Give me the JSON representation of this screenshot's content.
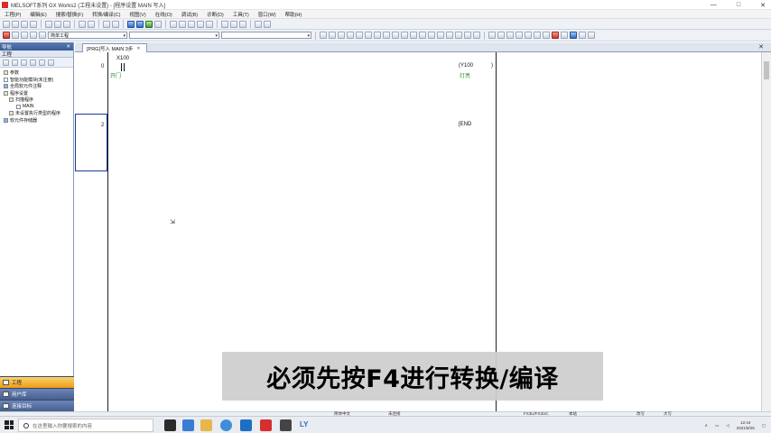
{
  "window": {
    "title": "MELSOFT系列 GX Works2 (工程未设置) - [程序设置 MAIN 写入]",
    "controls": [
      "—",
      "□",
      "✕"
    ]
  },
  "menu": [
    "工程(P)",
    "编辑(E)",
    "搜索/替换(F)",
    "转换/编译(C)",
    "视图(V)",
    "在线(O)",
    "调试(B)",
    "诊断(D)",
    "工具(T)",
    "窗口(W)",
    "帮助(H)"
  ],
  "toolbar": {
    "combo_label": "简单工程"
  },
  "nav": {
    "header": "导航",
    "subheader": "工程",
    "tree": [
      {
        "label": "参数",
        "icon": "folder",
        "depth": 0
      },
      {
        "label": "智能功能模块(未注册)",
        "icon": "doc",
        "depth": 0
      },
      {
        "label": "全局软元件注释",
        "icon": "doc",
        "depth": 0
      },
      {
        "label": "程序设置",
        "icon": "folder",
        "depth": 0
      },
      {
        "label": "扫描程序",
        "icon": "folder",
        "depth": 1
      },
      {
        "label": "MAIN",
        "icon": "doc",
        "depth": 2
      },
      {
        "label": "未设置执行类型的程序",
        "icon": "folder",
        "depth": 1
      },
      {
        "label": "软元件存储器",
        "icon": "doc",
        "depth": 0
      }
    ],
    "tabs": [
      {
        "label": "工程",
        "active": true
      },
      {
        "label": "用户库",
        "active": false
      },
      {
        "label": "连接目标",
        "active": false
      }
    ]
  },
  "editor": {
    "tab_label": "[PRG]写入 MAIN 3步",
    "steps": [
      "0",
      "2"
    ],
    "contact_device": "X100",
    "contact_comment": "开门",
    "coil_device": "(Y100",
    "coil_close": ")",
    "coil_comment": "灯亮",
    "end_instruction": "[END"
  },
  "caption": "必须先按F4进行转换/编译",
  "status": {
    "lang": "简体中文",
    "mode": "未连接",
    "cpu": "FX3U/FX3UC",
    "station": "本站",
    "edit_mode": "改写",
    "caps": "大写"
  },
  "taskbar": {
    "search_placeholder": "在这里输入你要搜索的内容",
    "ly_label": "LY",
    "time": "12:44",
    "date": "2021/8/25"
  }
}
